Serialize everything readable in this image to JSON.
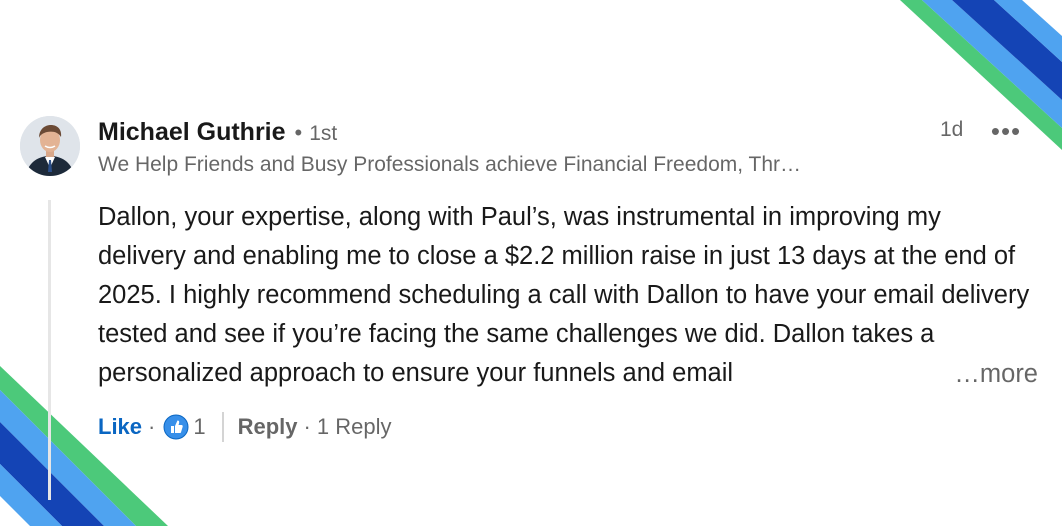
{
  "comment": {
    "author": "Michael Guthrie",
    "separator": "•",
    "degree": "1st",
    "headline": "We Help Friends and Busy Professionals achieve Financial Freedom, Thr…",
    "timestamp": "1d",
    "more_options_glyph": "•••",
    "body": "Dallon, your expertise, along with Paul’s, was instrumental in improving my delivery and enabling me to close a $2.2 million raise in just 13 days at the end of 2025. I highly recommend scheduling a call with Dallon to have your email delivery tested and see if you’re facing the same challenges we did. Dallon takes a personalized approach to ensure your funnels and email",
    "see_more": "…more"
  },
  "actions": {
    "like_label": "Like",
    "dot": "·",
    "reaction_icon": "thumbs-up-icon",
    "reaction_count": "1",
    "reply_label": "Reply",
    "reply_count": "1 Reply"
  },
  "colors": {
    "link_blue": "#0a66c2",
    "secondary_text": "#666666",
    "deco_dark_blue": "#1444b5",
    "deco_light_blue": "#4fa3f0",
    "deco_green": "#4cc97a"
  }
}
